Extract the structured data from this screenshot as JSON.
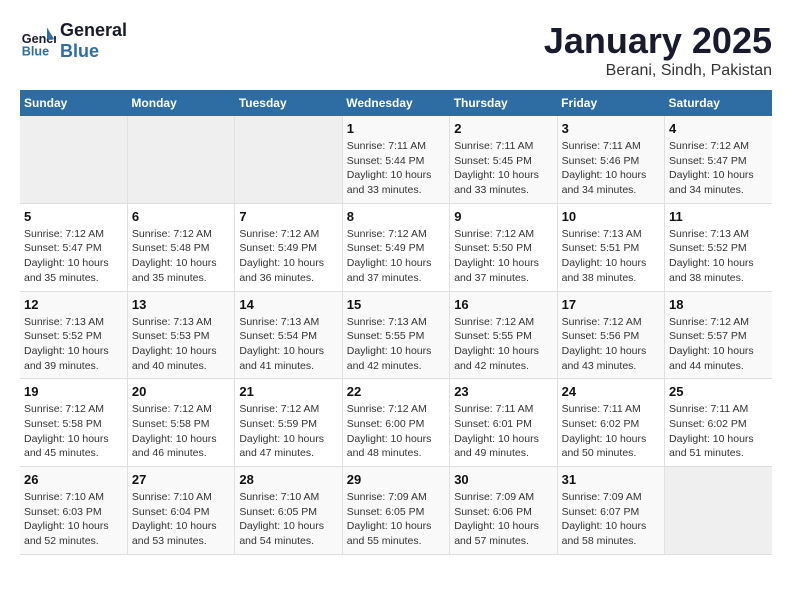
{
  "header": {
    "logo_line1": "General",
    "logo_line2": "Blue",
    "month": "January 2025",
    "location": "Berani, Sindh, Pakistan"
  },
  "weekdays": [
    "Sunday",
    "Monday",
    "Tuesday",
    "Wednesday",
    "Thursday",
    "Friday",
    "Saturday"
  ],
  "weeks": [
    [
      {
        "day": "",
        "sunrise": "",
        "sunset": "",
        "daylight": ""
      },
      {
        "day": "",
        "sunrise": "",
        "sunset": "",
        "daylight": ""
      },
      {
        "day": "",
        "sunrise": "",
        "sunset": "",
        "daylight": ""
      },
      {
        "day": "1",
        "sunrise": "Sunrise: 7:11 AM",
        "sunset": "Sunset: 5:44 PM",
        "daylight": "Daylight: 10 hours and 33 minutes."
      },
      {
        "day": "2",
        "sunrise": "Sunrise: 7:11 AM",
        "sunset": "Sunset: 5:45 PM",
        "daylight": "Daylight: 10 hours and 33 minutes."
      },
      {
        "day": "3",
        "sunrise": "Sunrise: 7:11 AM",
        "sunset": "Sunset: 5:46 PM",
        "daylight": "Daylight: 10 hours and 34 minutes."
      },
      {
        "day": "4",
        "sunrise": "Sunrise: 7:12 AM",
        "sunset": "Sunset: 5:47 PM",
        "daylight": "Daylight: 10 hours and 34 minutes."
      }
    ],
    [
      {
        "day": "5",
        "sunrise": "Sunrise: 7:12 AM",
        "sunset": "Sunset: 5:47 PM",
        "daylight": "Daylight: 10 hours and 35 minutes."
      },
      {
        "day": "6",
        "sunrise": "Sunrise: 7:12 AM",
        "sunset": "Sunset: 5:48 PM",
        "daylight": "Daylight: 10 hours and 35 minutes."
      },
      {
        "day": "7",
        "sunrise": "Sunrise: 7:12 AM",
        "sunset": "Sunset: 5:49 PM",
        "daylight": "Daylight: 10 hours and 36 minutes."
      },
      {
        "day": "8",
        "sunrise": "Sunrise: 7:12 AM",
        "sunset": "Sunset: 5:49 PM",
        "daylight": "Daylight: 10 hours and 37 minutes."
      },
      {
        "day": "9",
        "sunrise": "Sunrise: 7:12 AM",
        "sunset": "Sunset: 5:50 PM",
        "daylight": "Daylight: 10 hours and 37 minutes."
      },
      {
        "day": "10",
        "sunrise": "Sunrise: 7:13 AM",
        "sunset": "Sunset: 5:51 PM",
        "daylight": "Daylight: 10 hours and 38 minutes."
      },
      {
        "day": "11",
        "sunrise": "Sunrise: 7:13 AM",
        "sunset": "Sunset: 5:52 PM",
        "daylight": "Daylight: 10 hours and 38 minutes."
      }
    ],
    [
      {
        "day": "12",
        "sunrise": "Sunrise: 7:13 AM",
        "sunset": "Sunset: 5:52 PM",
        "daylight": "Daylight: 10 hours and 39 minutes."
      },
      {
        "day": "13",
        "sunrise": "Sunrise: 7:13 AM",
        "sunset": "Sunset: 5:53 PM",
        "daylight": "Daylight: 10 hours and 40 minutes."
      },
      {
        "day": "14",
        "sunrise": "Sunrise: 7:13 AM",
        "sunset": "Sunset: 5:54 PM",
        "daylight": "Daylight: 10 hours and 41 minutes."
      },
      {
        "day": "15",
        "sunrise": "Sunrise: 7:13 AM",
        "sunset": "Sunset: 5:55 PM",
        "daylight": "Daylight: 10 hours and 42 minutes."
      },
      {
        "day": "16",
        "sunrise": "Sunrise: 7:12 AM",
        "sunset": "Sunset: 5:55 PM",
        "daylight": "Daylight: 10 hours and 42 minutes."
      },
      {
        "day": "17",
        "sunrise": "Sunrise: 7:12 AM",
        "sunset": "Sunset: 5:56 PM",
        "daylight": "Daylight: 10 hours and 43 minutes."
      },
      {
        "day": "18",
        "sunrise": "Sunrise: 7:12 AM",
        "sunset": "Sunset: 5:57 PM",
        "daylight": "Daylight: 10 hours and 44 minutes."
      }
    ],
    [
      {
        "day": "19",
        "sunrise": "Sunrise: 7:12 AM",
        "sunset": "Sunset: 5:58 PM",
        "daylight": "Daylight: 10 hours and 45 minutes."
      },
      {
        "day": "20",
        "sunrise": "Sunrise: 7:12 AM",
        "sunset": "Sunset: 5:58 PM",
        "daylight": "Daylight: 10 hours and 46 minutes."
      },
      {
        "day": "21",
        "sunrise": "Sunrise: 7:12 AM",
        "sunset": "Sunset: 5:59 PM",
        "daylight": "Daylight: 10 hours and 47 minutes."
      },
      {
        "day": "22",
        "sunrise": "Sunrise: 7:12 AM",
        "sunset": "Sunset: 6:00 PM",
        "daylight": "Daylight: 10 hours and 48 minutes."
      },
      {
        "day": "23",
        "sunrise": "Sunrise: 7:11 AM",
        "sunset": "Sunset: 6:01 PM",
        "daylight": "Daylight: 10 hours and 49 minutes."
      },
      {
        "day": "24",
        "sunrise": "Sunrise: 7:11 AM",
        "sunset": "Sunset: 6:02 PM",
        "daylight": "Daylight: 10 hours and 50 minutes."
      },
      {
        "day": "25",
        "sunrise": "Sunrise: 7:11 AM",
        "sunset": "Sunset: 6:02 PM",
        "daylight": "Daylight: 10 hours and 51 minutes."
      }
    ],
    [
      {
        "day": "26",
        "sunrise": "Sunrise: 7:10 AM",
        "sunset": "Sunset: 6:03 PM",
        "daylight": "Daylight: 10 hours and 52 minutes."
      },
      {
        "day": "27",
        "sunrise": "Sunrise: 7:10 AM",
        "sunset": "Sunset: 6:04 PM",
        "daylight": "Daylight: 10 hours and 53 minutes."
      },
      {
        "day": "28",
        "sunrise": "Sunrise: 7:10 AM",
        "sunset": "Sunset: 6:05 PM",
        "daylight": "Daylight: 10 hours and 54 minutes."
      },
      {
        "day": "29",
        "sunrise": "Sunrise: 7:09 AM",
        "sunset": "Sunset: 6:05 PM",
        "daylight": "Daylight: 10 hours and 55 minutes."
      },
      {
        "day": "30",
        "sunrise": "Sunrise: 7:09 AM",
        "sunset": "Sunset: 6:06 PM",
        "daylight": "Daylight: 10 hours and 57 minutes."
      },
      {
        "day": "31",
        "sunrise": "Sunrise: 7:09 AM",
        "sunset": "Sunset: 6:07 PM",
        "daylight": "Daylight: 10 hours and 58 minutes."
      },
      {
        "day": "",
        "sunrise": "",
        "sunset": "",
        "daylight": ""
      }
    ]
  ]
}
